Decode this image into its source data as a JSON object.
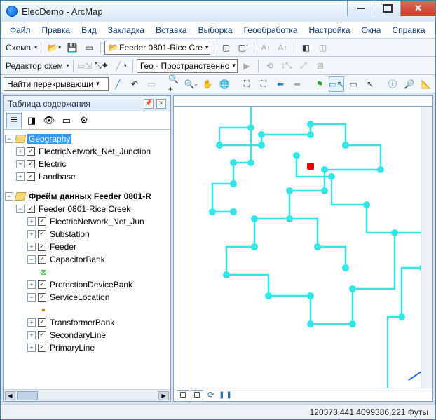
{
  "window": {
    "title": "ElecDemo - ArcMap"
  },
  "menus": [
    "Файл",
    "Правка",
    "Вид",
    "Закладка",
    "Вставка",
    "Выборка",
    "Геообработка",
    "Настройка",
    "Окна",
    "Справка"
  ],
  "toolbar1": {
    "schema_label": "Схема",
    "feeder_dropdown": "Feeder 0801-Rice Cre"
  },
  "toolbar2": {
    "editor_label": "Редактор схем",
    "geo_dropdown": "Гео - Пространственно"
  },
  "toolbar3": {
    "find_label": "Найти перекрывающи"
  },
  "toc": {
    "title": "Таблица содержания",
    "group1_label": "Geography",
    "group1_items": [
      "ElectricNetwork_Net_Junction",
      "Electric",
      "Landbase"
    ],
    "group2_label": "Фрейм данных Feeder 0801-R",
    "group2_root": "Feeder 0801-Rice Creek",
    "group2_items": [
      "ElectricNetwork_Net_Jun",
      "Substation",
      "Feeder",
      "CapacitorBank",
      "ProtectionDeviceBank",
      "ServiceLocation",
      "TransformerBank",
      "SecondaryLine",
      "PrimaryLine"
    ]
  },
  "status": {
    "coords": "120373,441 4099386,221 Футы"
  }
}
